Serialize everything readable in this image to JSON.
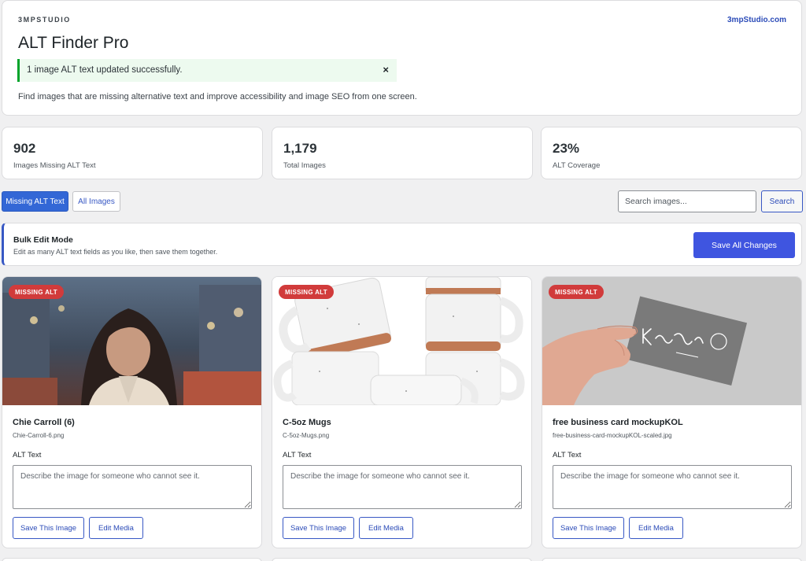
{
  "header": {
    "brand": "3MPSTUDIO",
    "site_link": "3mpStudio.com",
    "title": "ALT Finder Pro",
    "notice": "1 image ALT text updated successfully.",
    "notice_close": "×",
    "description": "Find images that are missing alternative text and improve accessibility and image SEO from one screen."
  },
  "stats": [
    {
      "value": "902",
      "label": "Images Missing ALT Text"
    },
    {
      "value": "1,179",
      "label": "Total Images"
    },
    {
      "value": "23%",
      "label": "ALT Coverage"
    }
  ],
  "filters": {
    "tabs": [
      {
        "label": "Missing ALT Text",
        "active": true
      },
      {
        "label": "All Images",
        "active": false
      }
    ],
    "search_placeholder": "Search images...",
    "search_button": "Search"
  },
  "bulk": {
    "title": "Bulk Edit Mode",
    "subtitle": "Edit as many ALT text fields as you like, then save them together.",
    "save_all": "Save All Changes"
  },
  "cards": [
    {
      "badge": "MISSING ALT",
      "title": "Chie Carroll (6)",
      "file": "Chie-Carroll-6.png",
      "alt_label": "ALT Text",
      "alt_placeholder": "Describe the image for someone who cannot see it.",
      "save": "Save This Image",
      "edit": "Edit Media"
    },
    {
      "badge": "MISSING ALT",
      "title": "C-5oz Mugs",
      "file": "C-5oz-Mugs.png",
      "alt_label": "ALT Text",
      "alt_placeholder": "Describe the image for someone who cannot see it.",
      "save": "Save This Image",
      "edit": "Edit Media"
    },
    {
      "badge": "MISSING ALT",
      "title": "free business card mockupKOL",
      "file": "free-business-card-mockupKOL-scaled.jpg",
      "alt_label": "ALT Text",
      "alt_placeholder": "Describe the image for someone who cannot see it.",
      "save": "Save This Image",
      "edit": "Edit Media"
    }
  ],
  "colors": {
    "accent": "#3367d6",
    "primary_button": "#3f55e0",
    "badge": "#d13b3b",
    "success": "#00a32a"
  }
}
